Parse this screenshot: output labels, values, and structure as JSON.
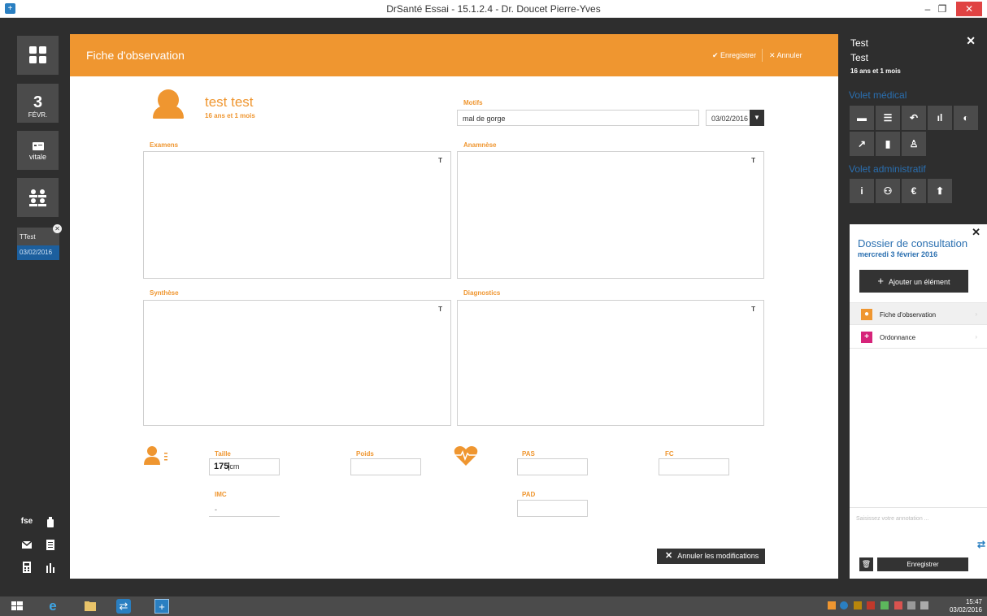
{
  "window": {
    "title": "DrSanté Essai - 15.1.2.4 - Dr. Doucet Pierre-Yves",
    "minimize_glyph": "–",
    "maximize_glyph": "❐",
    "close_glyph": "✕"
  },
  "left_rail": {
    "date_day": "3",
    "date_month": "FÉVR.",
    "vitale_label": "vitale",
    "patient_tab": {
      "name": "TTest",
      "date": "03/02/2016"
    },
    "fse_label": "fse"
  },
  "card": {
    "title": "Fiche d'observation",
    "save_label": "Enregistrer",
    "cancel_label": "Annuler",
    "patient_name": "test test",
    "patient_age": "16 ans et 1 mois",
    "motifs_label": "Motifs",
    "motifs_value": "mal de gorge",
    "date_value": "03/02/2016",
    "examens_label": "Examens",
    "anamnese_label": "Anamnèse",
    "synthese_label": "Synthèse",
    "diagnostics_label": "Diagnostics",
    "text_tool_glyph": "T",
    "taille_label": "Taille",
    "taille_value": "175",
    "taille_unit": "cm",
    "poids_label": "Poids",
    "pas_label": "PAS",
    "fc_label": "FC",
    "imc_label": "IMC",
    "imc_value": "-",
    "pad_label": "PAD",
    "cancel_modifications_label": "Annuler les modifications"
  },
  "right_panel": {
    "patient_first": "Test",
    "patient_last": "Test",
    "patient_age": "16 ans et 1 mois",
    "medical_section": "Volet médical",
    "admin_section": "Volet administratif",
    "dossier": {
      "title": "Dossier de consultation",
      "date": "mercredi 3 février 2016",
      "add_label": "Ajouter un élément",
      "items": [
        {
          "label": "Fiche d'observation",
          "color": "#ef9630"
        },
        {
          "label": "Ordonnance",
          "color": "#d6247a"
        }
      ],
      "annotation_placeholder": "Saisissez votre annotation ...",
      "save_label": "Enregistrer"
    }
  },
  "taskbar": {
    "time": "15:47",
    "date": "03/02/2016"
  },
  "colors": {
    "accent": "#ef9630",
    "blue": "#2a6fb0",
    "dark": "#2e2e2e"
  }
}
